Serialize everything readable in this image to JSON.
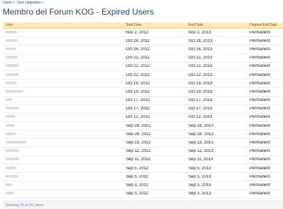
{
  "breadcrumb": [
    {
      "label": "Users",
      "sep": ">"
    },
    {
      "label": "User Upgrades",
      "sep": ">"
    }
  ],
  "page_title": "Membro del Forum KOG - Expired Users",
  "table": {
    "headers": {
      "user": "User",
      "start": "Start Date",
      "end": "End Date",
      "original": "Original End Date"
    },
    "rows": [
      {
        "start": "Nov 2, 2012",
        "end": "Nov 2, 2013",
        "original": "Permanent"
      },
      {
        "start": "Oct 28, 2012",
        "end": "Oct 28, 2013",
        "original": "Permanent"
      },
      {
        "start": "Oct 26, 2012",
        "end": "Oct 26, 2013",
        "original": "Permanent"
      },
      {
        "start": "Oct 22, 2012",
        "end": "Oct 22, 2013",
        "original": "Permanent"
      },
      {
        "start": "Oct 22, 2012",
        "end": "Oct 22, 2013",
        "original": "Permanent"
      },
      {
        "start": "Oct 22, 2012",
        "end": "Oct 22, 2013",
        "original": "Permanent"
      },
      {
        "start": "Oct 19, 2012",
        "end": "Oct 19, 2013",
        "original": "Permanent"
      },
      {
        "start": "Oct 19, 2012",
        "end": "Oct 19, 2013",
        "original": "Permanent"
      },
      {
        "start": "Oct 17, 2012",
        "end": "Oct 17, 2013",
        "original": "Permanent"
      },
      {
        "start": "Oct 17, 2012",
        "end": "Oct 17, 2013",
        "original": "Permanent"
      },
      {
        "start": "Oct 12, 2012",
        "end": "Oct 12, 2013",
        "original": "Permanent"
      },
      {
        "start": "Sep 28, 2012",
        "end": "Sep 28, 2013",
        "original": "Permanent"
      },
      {
        "start": "Sep 28, 2012",
        "end": "Sep 28, 2013",
        "original": "Permanent"
      },
      {
        "start": "Sep 13, 2012",
        "end": "Sep 13, 2013",
        "original": "Permanent"
      },
      {
        "start": "Sep 12, 2012",
        "end": "Sep 12, 2013",
        "original": "Permanent"
      },
      {
        "start": "Sep 11, 2012",
        "end": "Sep 11, 2013",
        "original": "Permanent"
      },
      {
        "start": "Sep 5, 2012",
        "end": "Sep 5, 2013",
        "original": "Permanent"
      },
      {
        "start": "Sep 5, 2012",
        "end": "Sep 5, 2013",
        "original": "Permanent"
      },
      {
        "start": "Sep 3, 2012",
        "end": "Sep 3, 2013",
        "original": "Permanent"
      },
      {
        "start": "Sep 3, 2012",
        "end": "Sep 3, 2013",
        "original": "Permanent"
      }
    ]
  },
  "footer": {
    "text": "Showing 20 of 251 items"
  },
  "colors": {
    "header_bg": "#ffe8c0",
    "title": "#2b485c",
    "link": "#2b485c"
  }
}
